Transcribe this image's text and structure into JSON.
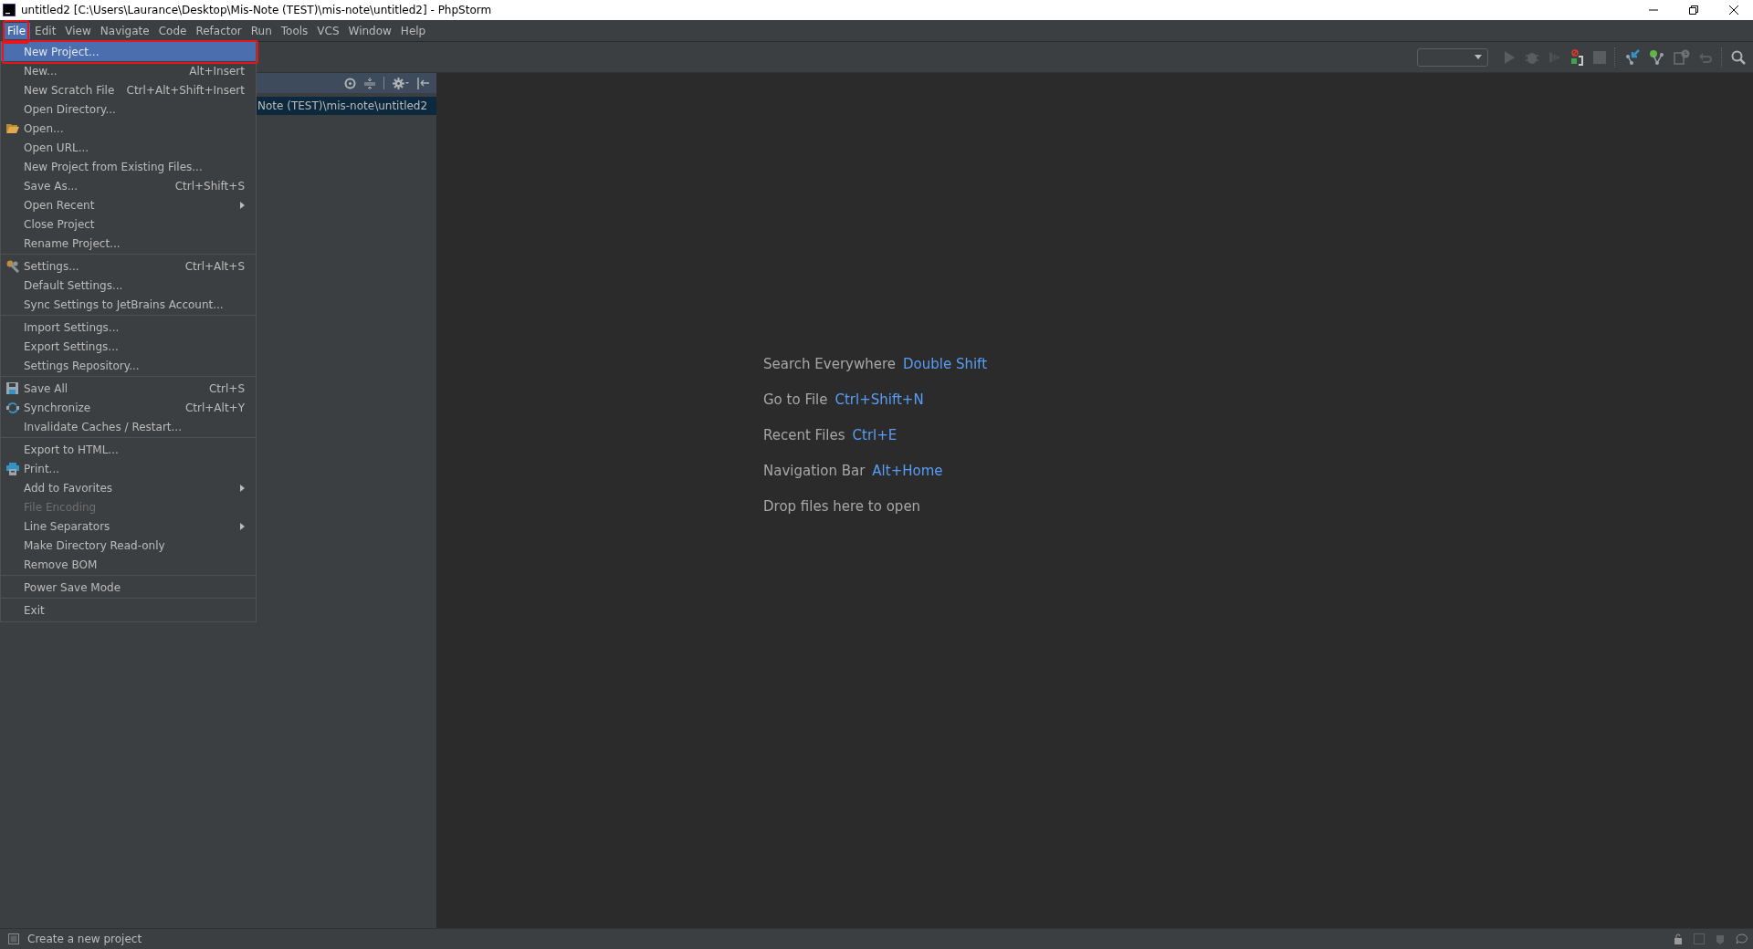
{
  "window": {
    "title": "untitled2 [C:\\Users\\Laurance\\Desktop\\Mis-Note (TEST)\\mis-note\\untitled2] - PhpStorm"
  },
  "menu_bar": [
    {
      "label": "File",
      "selected": true
    },
    {
      "label": "Edit",
      "selected": false
    },
    {
      "label": "View",
      "selected": false
    },
    {
      "label": "Navigate",
      "selected": false
    },
    {
      "label": "Code",
      "selected": false
    },
    {
      "label": "Refactor",
      "selected": false
    },
    {
      "label": "Run",
      "selected": false
    },
    {
      "label": "Tools",
      "selected": false
    },
    {
      "label": "VCS",
      "selected": false
    },
    {
      "label": "Window",
      "selected": false
    },
    {
      "label": "Help",
      "selected": false
    }
  ],
  "file_menu": [
    {
      "kind": "item",
      "label": "New Project...",
      "selected": true,
      "disabled": false
    },
    {
      "kind": "item",
      "label": "New...",
      "shortcut": "Alt+Insert",
      "selected": false,
      "disabled": false
    },
    {
      "kind": "item",
      "label": "New Scratch File",
      "shortcut": "Ctrl+Alt+Shift+Insert",
      "selected": false,
      "disabled": false
    },
    {
      "kind": "item",
      "label": "Open Directory...",
      "selected": false,
      "disabled": false
    },
    {
      "kind": "item",
      "label": "Open...",
      "selected": false,
      "disabled": false
    },
    {
      "kind": "item",
      "label": "Open URL...",
      "selected": false,
      "disabled": false
    },
    {
      "kind": "item",
      "label": "New Project from Existing Files...",
      "selected": false,
      "disabled": false
    },
    {
      "kind": "item",
      "label": "Save As...",
      "shortcut": "Ctrl+Shift+S",
      "selected": false,
      "disabled": false
    },
    {
      "kind": "item",
      "label": "Open Recent",
      "submenu": true,
      "selected": false,
      "disabled": false
    },
    {
      "kind": "item",
      "label": "Close Project",
      "selected": false,
      "disabled": false
    },
    {
      "kind": "item",
      "label": "Rename Project...",
      "selected": false,
      "disabled": false
    },
    {
      "kind": "separator"
    },
    {
      "kind": "item",
      "label": "Settings...",
      "shortcut": "Ctrl+Alt+S",
      "selected": false,
      "disabled": false
    },
    {
      "kind": "item",
      "label": "Default Settings...",
      "selected": false,
      "disabled": false
    },
    {
      "kind": "item",
      "label": "Sync Settings to JetBrains Account...",
      "selected": false,
      "disabled": false
    },
    {
      "kind": "separator"
    },
    {
      "kind": "item",
      "label": "Import Settings...",
      "selected": false,
      "disabled": false
    },
    {
      "kind": "item",
      "label": "Export Settings...",
      "selected": false,
      "disabled": false
    },
    {
      "kind": "item",
      "label": "Settings Repository...",
      "selected": false,
      "disabled": false
    },
    {
      "kind": "separator"
    },
    {
      "kind": "item",
      "label": "Save All",
      "shortcut": "Ctrl+S",
      "selected": false,
      "disabled": false
    },
    {
      "kind": "item",
      "label": "Synchronize",
      "shortcut": "Ctrl+Alt+Y",
      "selected": false,
      "disabled": false
    },
    {
      "kind": "item",
      "label": "Invalidate Caches / Restart...",
      "selected": false,
      "disabled": false
    },
    {
      "kind": "separator"
    },
    {
      "kind": "item",
      "label": "Export to HTML...",
      "selected": false,
      "disabled": false
    },
    {
      "kind": "item",
      "label": "Print...",
      "selected": false,
      "disabled": false
    },
    {
      "kind": "item",
      "label": "Add to Favorites",
      "submenu": true,
      "selected": false,
      "disabled": false
    },
    {
      "kind": "item",
      "label": "File Encoding",
      "selected": false,
      "disabled": true
    },
    {
      "kind": "item",
      "label": "Line Separators",
      "submenu": true,
      "selected": false,
      "disabled": false
    },
    {
      "kind": "item",
      "label": "Make Directory Read-only",
      "selected": false,
      "disabled": false
    },
    {
      "kind": "item",
      "label": "Remove BOM",
      "selected": false,
      "disabled": false
    },
    {
      "kind": "separator"
    },
    {
      "kind": "item",
      "label": "Power Save Mode",
      "selected": false,
      "disabled": false
    },
    {
      "kind": "separator"
    },
    {
      "kind": "item",
      "label": "Exit",
      "selected": false,
      "disabled": false
    }
  ],
  "project_panel": {
    "tree": [
      {
        "label": "Note (TEST)\\mis-note\\untitled2",
        "selected": true
      }
    ]
  },
  "editor_hints": [
    {
      "label": "Search Everywhere",
      "shortcut": "Double Shift"
    },
    {
      "label": "Go to File",
      "shortcut": "Ctrl+Shift+N"
    },
    {
      "label": "Recent Files",
      "shortcut": "Ctrl+E"
    },
    {
      "label": "Navigation Bar",
      "shortcut": "Alt+Home"
    },
    {
      "label": "Drop files here to open"
    }
  ],
  "status_bar": {
    "message": "Create a new project"
  }
}
